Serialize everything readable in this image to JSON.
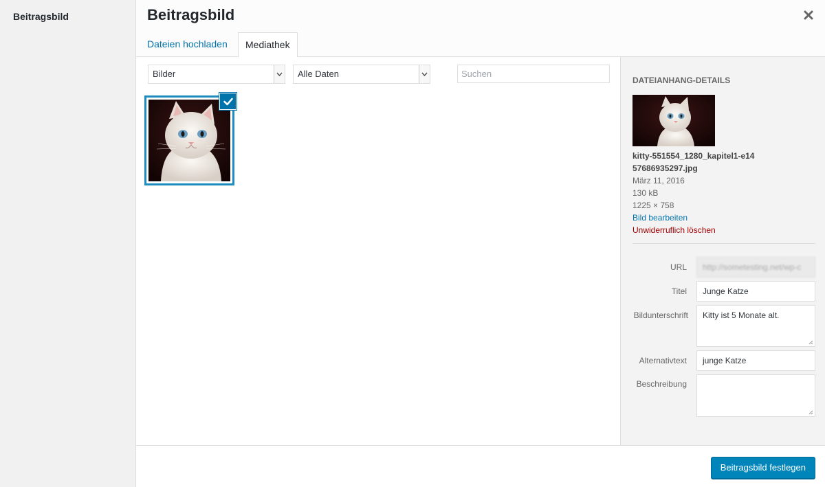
{
  "sidebar": {
    "title": "Beitragsbild"
  },
  "header": {
    "title": "Beitragsbild",
    "close_glyph": "✕",
    "tabs": [
      {
        "label": "Dateien hochladen",
        "active": false
      },
      {
        "label": "Mediathek",
        "active": true
      }
    ]
  },
  "toolbar": {
    "type_filter": "Bilder",
    "date_filter": "Alle Daten",
    "search_placeholder": "Suchen"
  },
  "grid": {
    "items": [
      {
        "selected": true,
        "icon": "kitten-thumbnail"
      }
    ]
  },
  "details": {
    "heading": "Dateianhang-Details",
    "filename": "kitty-551554_1280_kapitel1-e1457686935297.jpg",
    "date": "März 11, 2016",
    "size": "130 kB",
    "dimensions": "1225 × 758",
    "edit_link": "Bild bearbeiten",
    "delete_link": "Unwiderruflich löschen",
    "fields": {
      "url_label": "URL",
      "url_value": "http://sometesting.net/wp-c",
      "title_label": "Titel",
      "title_value": "Junge Katze",
      "caption_label": "Bildunterschrift",
      "caption_value": "Kitty ist 5 Monate alt.",
      "alt_label": "Alternativtext",
      "alt_value": "junge Katze",
      "description_label": "Beschreibung",
      "description_value": ""
    }
  },
  "footer": {
    "primary_label": "Beitragsbild festlegen"
  },
  "colors": {
    "accent": "#0073aa",
    "primary_button": "#0085ba",
    "delete": "#a00000",
    "selection_border": "#1e8cbe"
  }
}
